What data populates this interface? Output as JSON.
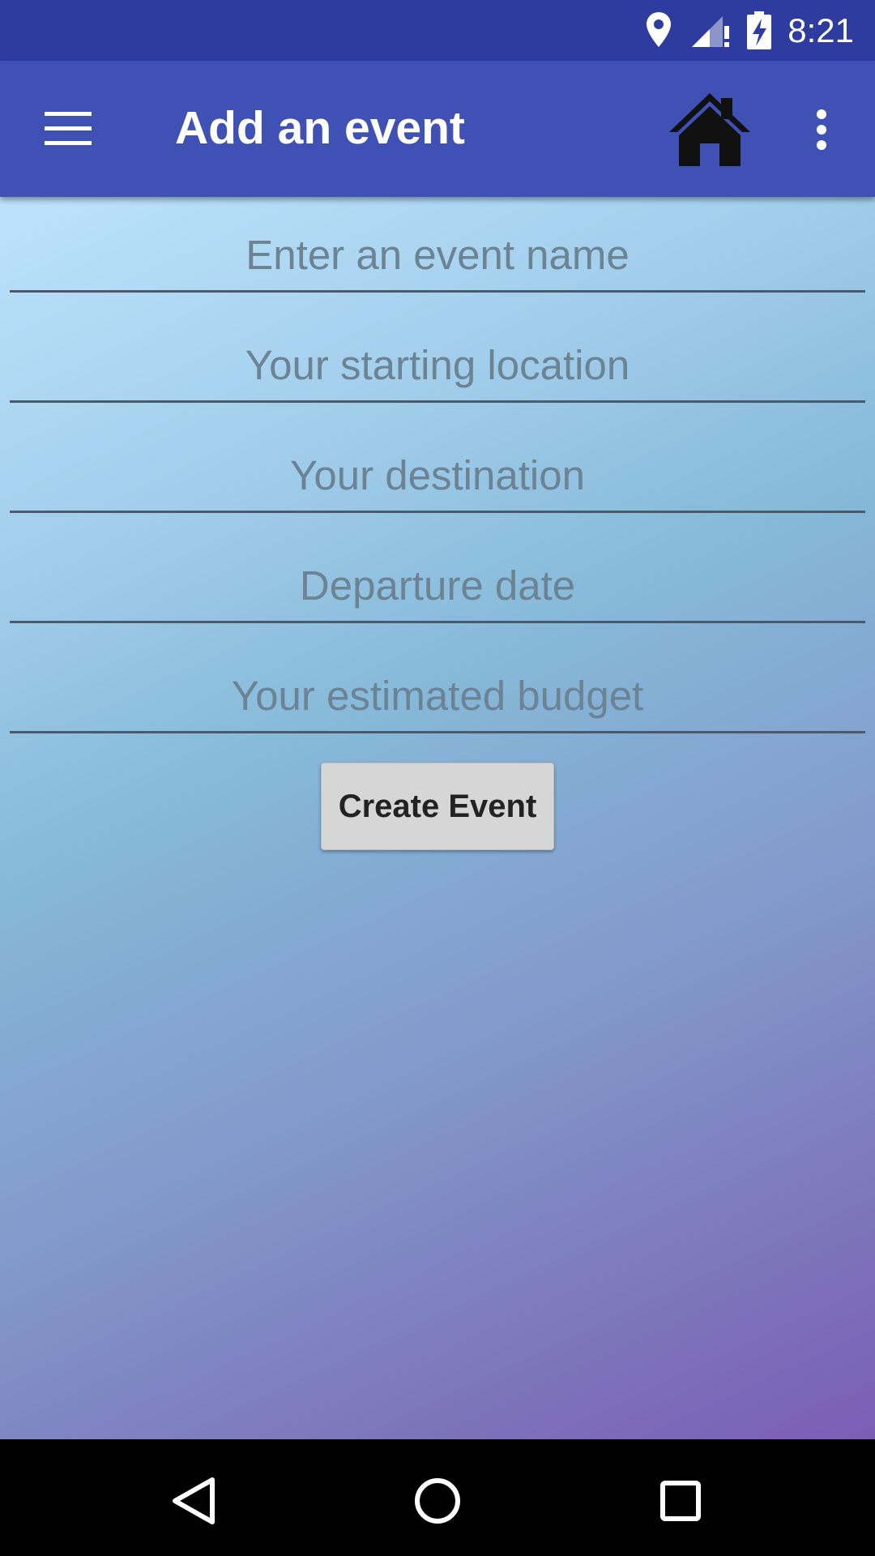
{
  "status_bar": {
    "time": "8:21",
    "icons": [
      "location-icon",
      "signal-icon",
      "battery-charging-icon"
    ]
  },
  "app_bar": {
    "title": "Add an event",
    "icons": [
      "menu-icon",
      "home-icon",
      "more-vert-icon"
    ],
    "color": "#3f51b5"
  },
  "form": {
    "event_name_placeholder": "Enter an event name",
    "starting_location_placeholder": "Your starting location",
    "destination_placeholder": "Your destination",
    "departure_date_placeholder": "Departure date",
    "budget_placeholder": "Your estimated budget",
    "create_button_label": "Create Event"
  },
  "nav_bar": {
    "icons": [
      "back-icon",
      "home-circle-icon",
      "recents-icon"
    ]
  }
}
